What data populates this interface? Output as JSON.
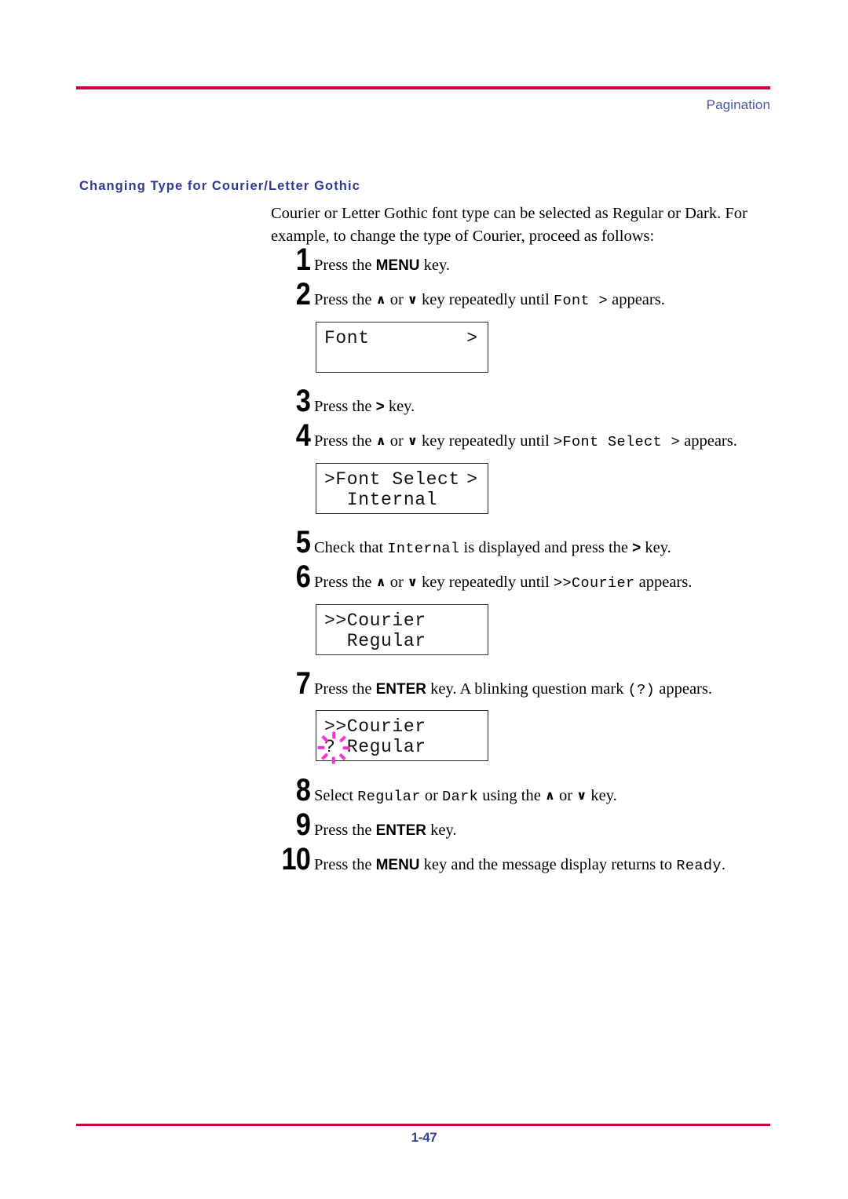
{
  "header": {
    "running_head": "Pagination",
    "rule_color": "#c8003c"
  },
  "section": {
    "heading": "Changing Type for Courier/Letter Gothic",
    "heading_color": "#2e3a93",
    "intro": "Courier or Letter Gothic font type can be selected as Regular or Dark. For example, to change the type of Courier, proceed as follows:"
  },
  "steps": [
    {
      "number": "1",
      "parts": [
        {
          "t": "Press the ",
          "s": "plain"
        },
        {
          "t": "MENU",
          "s": "key"
        },
        {
          "t": " key.",
          "s": "plain"
        }
      ]
    },
    {
      "number": "2",
      "parts": [
        {
          "t": "Press the ",
          "s": "plain"
        },
        {
          "t": "∧",
          "s": "chev"
        },
        {
          "t": " or ",
          "s": "plain"
        },
        {
          "t": "∨",
          "s": "chev"
        },
        {
          "t": " key repeatedly until ",
          "s": "plain"
        },
        {
          "t": "Font >",
          "s": "mono"
        },
        {
          "t": " appears.",
          "s": "plain"
        }
      ]
    },
    {
      "number": "3",
      "parts": [
        {
          "t": "Press the ",
          "s": "plain"
        },
        {
          "t": ">",
          "s": "gt"
        },
        {
          "t": " key.",
          "s": "plain"
        }
      ]
    },
    {
      "number": "4",
      "parts": [
        {
          "t": "Press the ",
          "s": "plain"
        },
        {
          "t": "∧",
          "s": "chev"
        },
        {
          "t": " or ",
          "s": "plain"
        },
        {
          "t": "∨",
          "s": "chev"
        },
        {
          "t": " key repeatedly until ",
          "s": "plain"
        },
        {
          "t": ">Font Select >",
          "s": "mono"
        },
        {
          "t": " appears.",
          "s": "plain"
        }
      ]
    },
    {
      "number": "5",
      "parts": [
        {
          "t": "Check that ",
          "s": "plain"
        },
        {
          "t": "Internal",
          "s": "mono"
        },
        {
          "t": " is displayed and press the ",
          "s": "plain"
        },
        {
          "t": ">",
          "s": "gt"
        },
        {
          "t": " key.",
          "s": "plain"
        }
      ]
    },
    {
      "number": "6",
      "parts": [
        {
          "t": "Press the ",
          "s": "plain"
        },
        {
          "t": "∧",
          "s": "chev"
        },
        {
          "t": " or ",
          "s": "plain"
        },
        {
          "t": "∨",
          "s": "chev"
        },
        {
          "t": " key repeatedly until ",
          "s": "plain"
        },
        {
          "t": ">>Courier",
          "s": "mono"
        },
        {
          "t": " appears.",
          "s": "plain"
        }
      ]
    },
    {
      "number": "7",
      "parts": [
        {
          "t": "Press the ",
          "s": "plain"
        },
        {
          "t": "ENTER",
          "s": "key"
        },
        {
          "t": " key. A blinking question mark ",
          "s": "plain"
        },
        {
          "t": "(?)",
          "s": "mono"
        },
        {
          "t": " appears.",
          "s": "plain"
        }
      ]
    },
    {
      "number": "8",
      "parts": [
        {
          "t": "Select ",
          "s": "plain"
        },
        {
          "t": "Regular",
          "s": "mono"
        },
        {
          "t": " or ",
          "s": "plain"
        },
        {
          "t": "Dark",
          "s": "mono"
        },
        {
          "t": " using the ",
          "s": "plain"
        },
        {
          "t": "∧",
          "s": "chev"
        },
        {
          "t": " or ",
          "s": "plain"
        },
        {
          "t": "∨",
          "s": "chev"
        },
        {
          "t": " key.",
          "s": "plain"
        }
      ]
    },
    {
      "number": "9",
      "parts": [
        {
          "t": "Press the ",
          "s": "plain"
        },
        {
          "t": "ENTER",
          "s": "key"
        },
        {
          "t": " key.",
          "s": "plain"
        }
      ]
    },
    {
      "number": "10",
      "parts": [
        {
          "t": "Press the ",
          "s": "plain"
        },
        {
          "t": "MENU",
          "s": "key"
        },
        {
          "t": " key and the message display returns to ",
          "s": "plain"
        },
        {
          "t": "Ready",
          "s": "mono"
        },
        {
          "t": ".",
          "s": "plain"
        }
      ]
    }
  ],
  "lcd_displays": [
    {
      "id": "font",
      "line1": "Font",
      "line2": "",
      "right_arrow": ">",
      "blinking_marker": false
    },
    {
      "id": "font-select",
      "line1": ">Font Select",
      "line2": "  Internal",
      "right_arrow": ">",
      "blinking_marker": false
    },
    {
      "id": "courier-regular",
      "line1": ">>Courier",
      "line2": "  Regular",
      "right_arrow": "",
      "blinking_marker": false
    },
    {
      "id": "courier-regular-blinking",
      "line1": ">>Courier",
      "line2": "? Regular",
      "right_arrow": "",
      "blinking_marker": true,
      "marker_color": "#ff2fd0"
    }
  ],
  "footer": {
    "page_number": "1-47",
    "rule_color": "#c8003c",
    "page_number_color": "#33409a"
  }
}
